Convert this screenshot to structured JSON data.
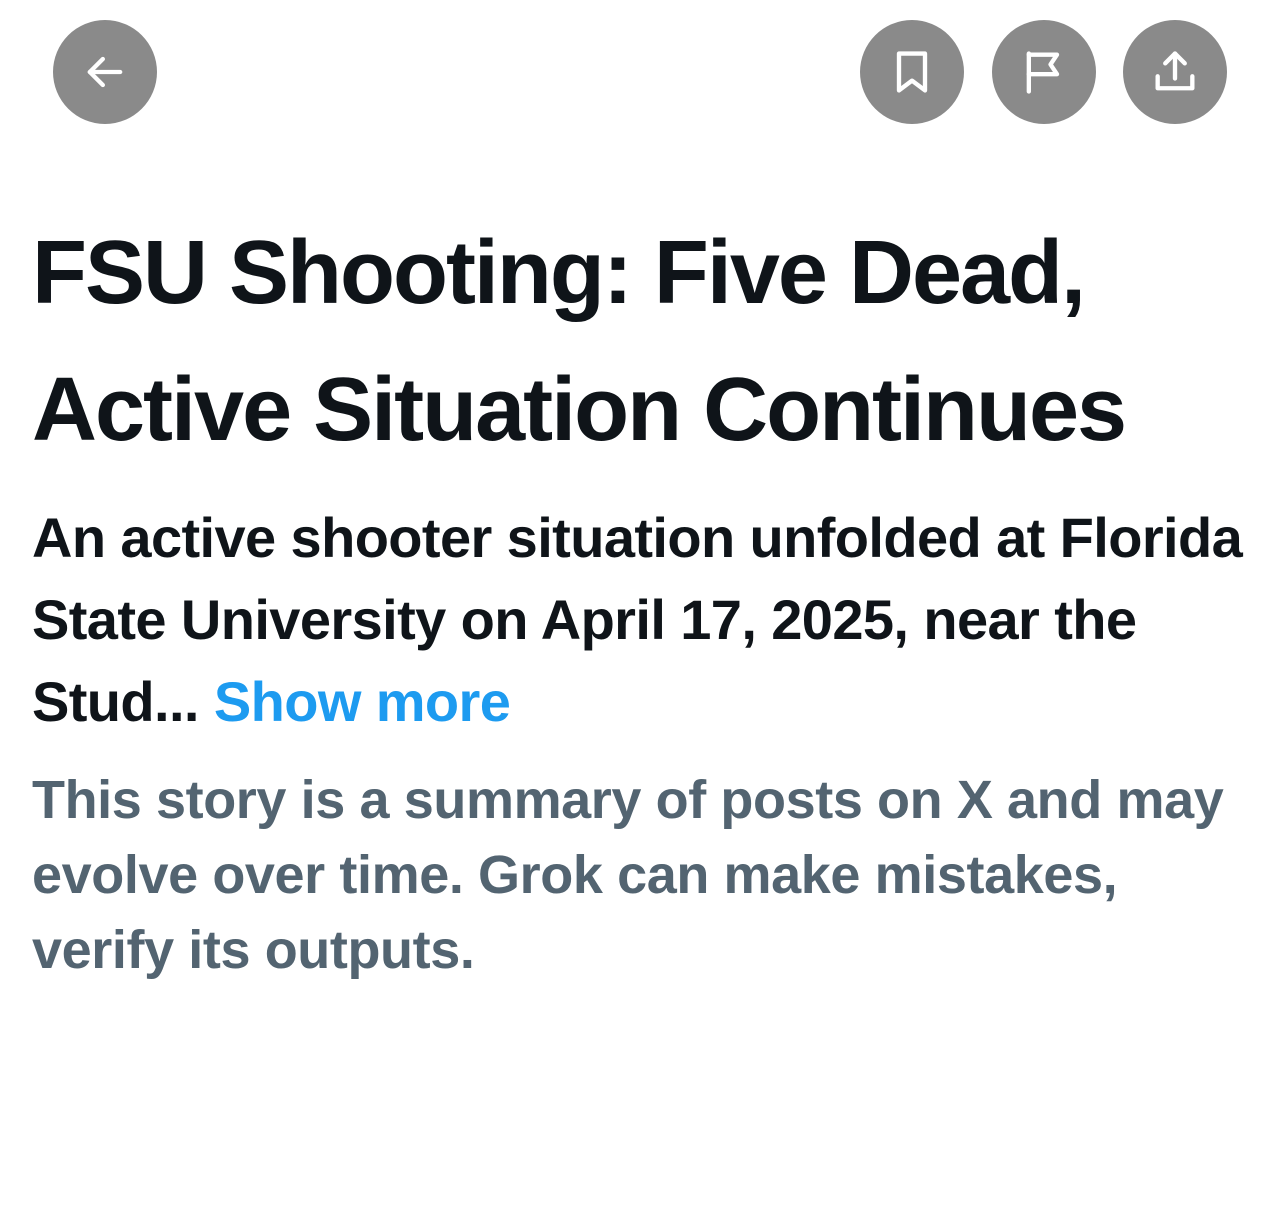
{
  "icons": {
    "back": "arrow-left-icon",
    "bookmark": "bookmark-icon",
    "report": "flag-icon",
    "share": "share-upload-icon"
  },
  "colors": {
    "button_bg": "#8a8a8a",
    "icon": "#ffffff",
    "headline": "#0f1419",
    "link": "#1d9bf0",
    "muted": "#536471"
  },
  "story": {
    "title": "FSU Shooting: Five Dead, Active Situation Continues",
    "summary": "An active shooter situation unfolded at Florida State University on April 17, 2025, near the Stud...",
    "show_more_label": "Show more",
    "disclaimer": "This story is a summary of posts on X and may evolve over time. Grok can make mistakes, verify its outputs."
  }
}
